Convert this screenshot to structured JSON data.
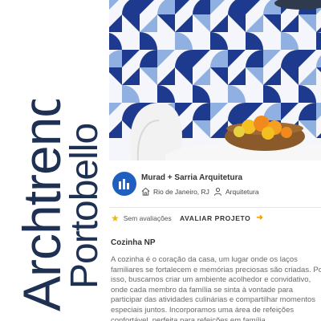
{
  "brand": {
    "title": "Archtrends",
    "subtitle": "Portobello",
    "color": "#1f3153"
  },
  "office": {
    "name": "Murad + Sarria Arquitetura",
    "location": "Rio de Janeiro, RJ",
    "category": "Arquitetura",
    "logo_color": "#1e5fc0",
    "logo_icon": "building-logo-icon",
    "location_icon": "home-icon",
    "category_icon": "person-icon"
  },
  "rating": {
    "label": "Sem avaliações",
    "star_icon": "star-icon",
    "star_color": "#f5b800"
  },
  "actions": {
    "evaluate_label": "AVALIAR PROJETO",
    "arrow_icon": "arrow-right-icon",
    "arrow_color": "#f5a000"
  },
  "project": {
    "title": "Cozinha NP",
    "description": "A cozinha é o coração da casa, um lugar onde os laços familiares se fortalecem e memórias preciosas são criadas. Por isso, buscamos criar um ambiente acolhedor e convidativo, onde cada membro da família se sinta à vontade para participar das atividades culinárias e compartilhar momentos especiais juntos. Incorporamos uma área de refeições confortável, perfeita para refeições em família."
  },
  "photo": {
    "tile_dark": "#1d3a8f",
    "tile_light": "#8fb0e0",
    "tile_bg": "#f4f6fb"
  }
}
